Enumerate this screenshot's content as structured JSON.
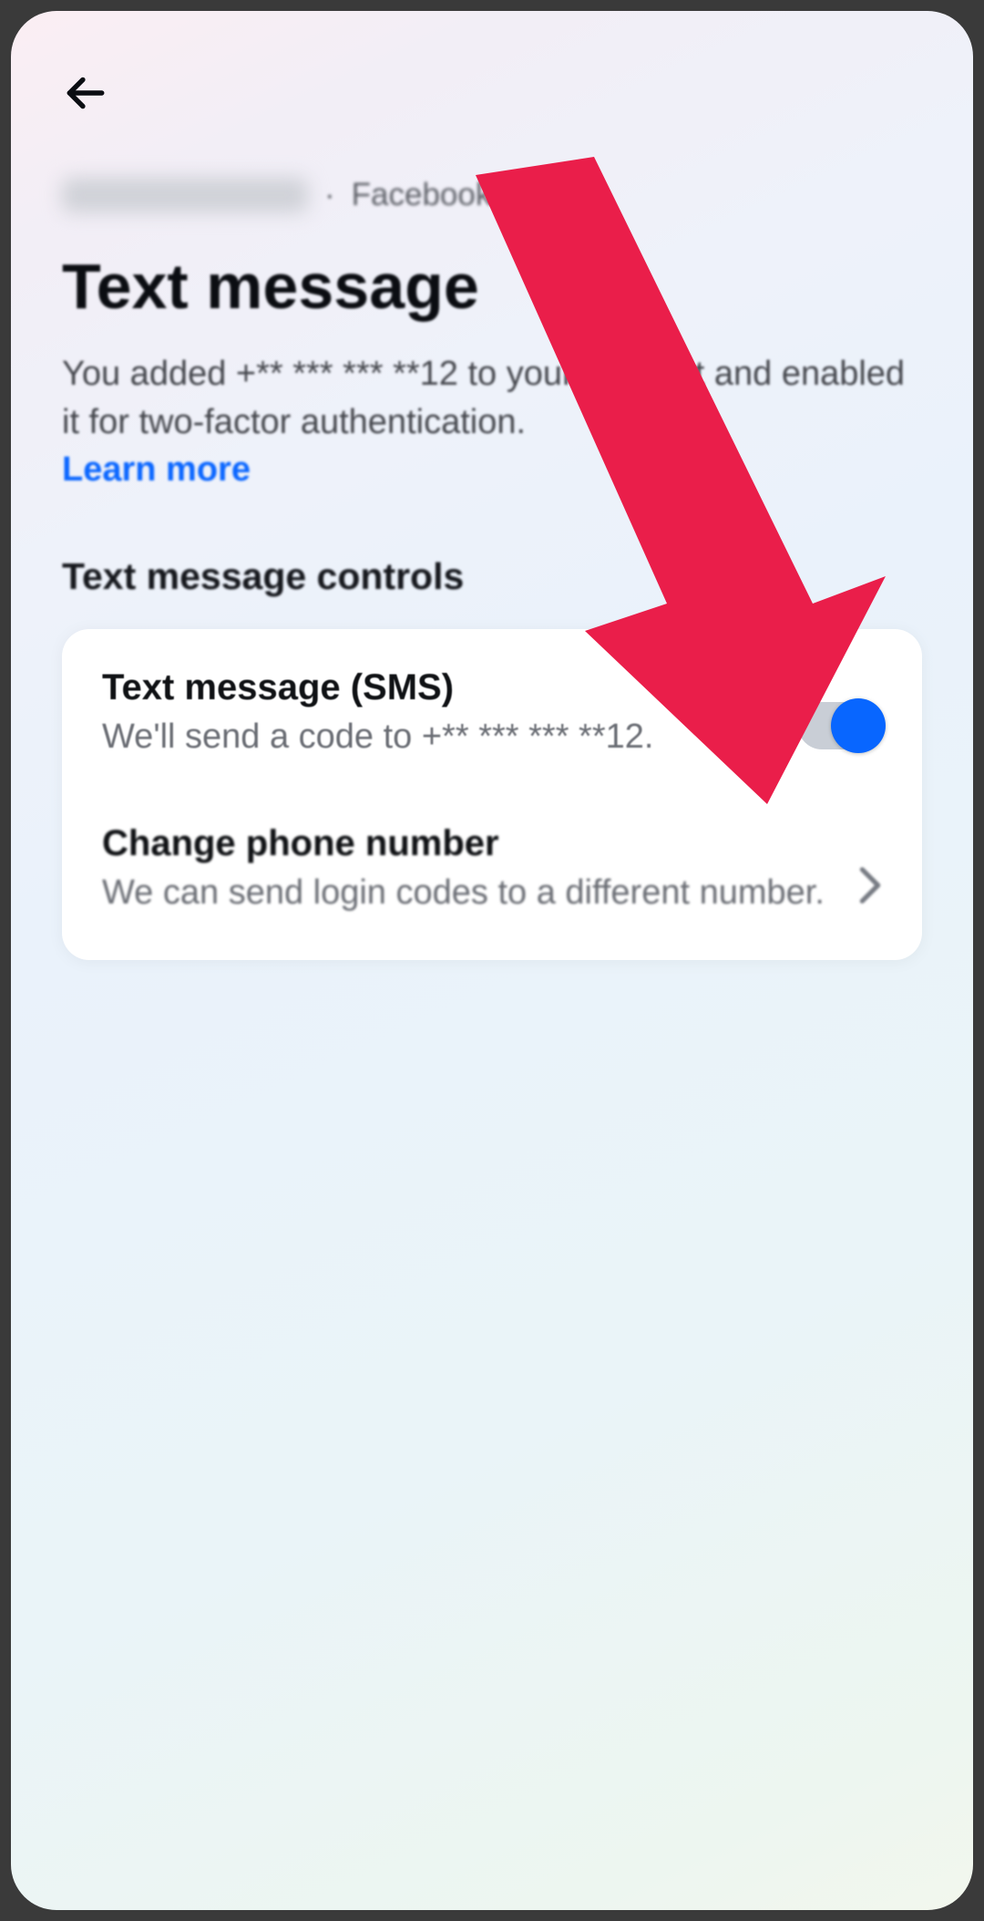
{
  "breadcrumb": {
    "app": "Facebook"
  },
  "title": "Text message",
  "description": "You added +** *** *** **12 to your account and enabled it for two-factor authentication.",
  "learn_more": "Learn more",
  "section_heading": "Text message controls",
  "sms": {
    "title": "Text message (SMS)",
    "subtitle": "We'll send a code to +** *** *** **12.",
    "enabled": true
  },
  "change": {
    "title": "Change phone number",
    "subtitle": "We can send login codes to a different number."
  },
  "annotation": {
    "arrow_color": "#ea1e4a"
  }
}
